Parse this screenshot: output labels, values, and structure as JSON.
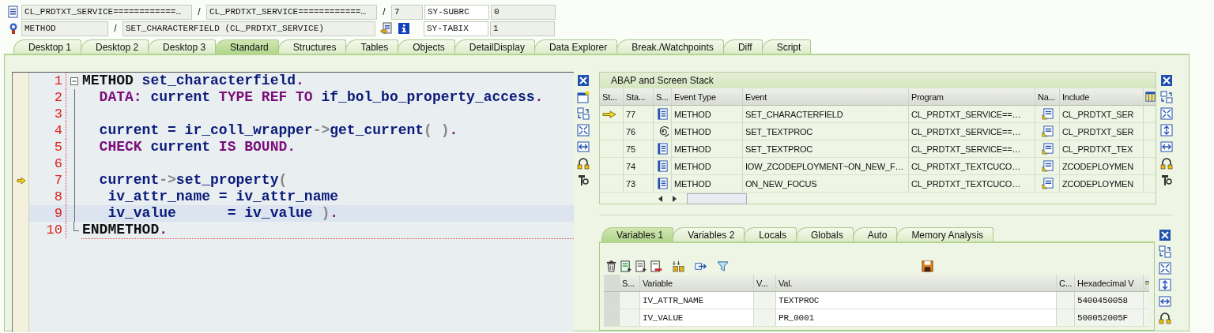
{
  "header": {
    "row_1": {
      "program": "CL_PRDTXT_SERVICE============…",
      "include": "CL_PRDTXT_SERVICE============…",
      "line": "7",
      "field_name": "SY-SUBRC",
      "field_value": "0"
    },
    "row_2": {
      "event_type": "METHOD",
      "event": "SET_CHARACTERFIELD (CL_PRDTXT_SERVICE)",
      "field_name": "SY-TABIX",
      "field_value": "1"
    },
    "separator": "/"
  },
  "tabs": [
    {
      "label": "Desktop 1",
      "selected": false
    },
    {
      "label": "Desktop 2",
      "selected": false
    },
    {
      "label": "Desktop 3",
      "selected": false
    },
    {
      "label": "Standard",
      "selected": true
    },
    {
      "label": "Structures",
      "selected": false
    },
    {
      "label": "Tables",
      "selected": false
    },
    {
      "label": "Objects",
      "selected": false
    },
    {
      "label": "DetailDisplay",
      "selected": false
    },
    {
      "label": "Data Explorer",
      "selected": false
    },
    {
      "label": "Break./Watchpoints",
      "selected": false
    },
    {
      "label": "Diff",
      "selected": false
    },
    {
      "label": "Script",
      "selected": false
    }
  ],
  "source_code": {
    "lines": [
      {
        "number": "1",
        "execution_marker": false,
        "highlighted": false,
        "tokens": [
          {
            "text": "METHOD",
            "kind": "keyword"
          },
          {
            "text": " set_characterfield",
            "kind": "name"
          },
          {
            "text": ".",
            "kind": "statement"
          }
        ]
      },
      {
        "number": "2",
        "execution_marker": false,
        "highlighted": false,
        "tokens": [
          {
            "text": "  DATA:",
            "kind": "statement"
          },
          {
            "text": " current",
            "kind": "name"
          },
          {
            "text": " TYPE REF TO",
            "kind": "statement"
          },
          {
            "text": " if_bol_bo_property_access",
            "kind": "name"
          },
          {
            "text": ".",
            "kind": "statement"
          }
        ]
      },
      {
        "number": "3",
        "execution_marker": false,
        "highlighted": false
      },
      {
        "number": "4",
        "execution_marker": false,
        "highlighted": false,
        "tokens": [
          {
            "text": "  current = ir_coll_wrapper",
            "kind": "name"
          },
          {
            "text": "->",
            "kind": "operator"
          },
          {
            "text": "get_current",
            "kind": "name"
          },
          {
            "text": "( )",
            "kind": "operator"
          },
          {
            "text": ".",
            "kind": "statement"
          }
        ]
      },
      {
        "number": "5",
        "execution_marker": false,
        "highlighted": false,
        "tokens": [
          {
            "text": "  CHECK",
            "kind": "statement"
          },
          {
            "text": " current",
            "kind": "name"
          },
          {
            "text": " IS BOUND",
            "kind": "statement"
          },
          {
            "text": ".",
            "kind": "statement"
          }
        ]
      },
      {
        "number": "6",
        "execution_marker": false,
        "highlighted": false
      },
      {
        "number": "7",
        "execution_marker": true,
        "highlighted": false,
        "tokens": [
          {
            "text": "  current",
            "kind": "name"
          },
          {
            "text": "->",
            "kind": "operator"
          },
          {
            "text": "set_property",
            "kind": "name"
          },
          {
            "text": "(",
            "kind": "operator"
          }
        ]
      },
      {
        "number": "8",
        "execution_marker": false,
        "highlighted": false,
        "tokens": [
          {
            "text": "   iv_attr_name = iv_attr_name",
            "kind": "name"
          }
        ]
      },
      {
        "number": "9",
        "execution_marker": false,
        "highlighted": true,
        "tokens": [
          {
            "text": "   iv_value      = iv_value",
            "kind": "name"
          },
          {
            "text": " )",
            "kind": "operator"
          },
          {
            "text": ".",
            "kind": "statement"
          }
        ]
      },
      {
        "number": "10",
        "execution_marker": false,
        "highlighted": false,
        "tokens": [
          {
            "text": "ENDMETHOD",
            "kind": "keyword"
          },
          {
            "text": ".",
            "kind": "statement"
          }
        ]
      }
    ]
  },
  "stack": {
    "title": "ABAP and Screen Stack",
    "columns": [
      "St...",
      "Sta...",
      "S...",
      "Event Type",
      "Event",
      "Program",
      "Na...",
      "Include"
    ],
    "rows": [
      {
        "current": true,
        "number": "77",
        "kind": "document",
        "event_type": "METHOD",
        "event": "SET_CHARACTERFIELD",
        "program": "CL_PRDTXT_SERVICE==…",
        "include": "CL_PRDTXT_SER"
      },
      {
        "current": false,
        "number": "76",
        "kind": "spiral",
        "event_type": "METHOD",
        "event": "SET_TEXTPROC",
        "program": "CL_PRDTXT_SERVICE==…",
        "include": "CL_PRDTXT_SER"
      },
      {
        "current": false,
        "number": "75",
        "kind": "document",
        "event_type": "METHOD",
        "event": "SET_TEXTPROC",
        "program": "CL_PRDTXT_SERVICE==…",
        "include": "CL_PRDTXT_TEX"
      },
      {
        "current": false,
        "number": "74",
        "kind": "document",
        "event_type": "METHOD",
        "event": "IOW_ZCODEPLOYMENT~ON_NEW_F…",
        "program": "CL_PRDTXT_TEXTCUCO…",
        "include": "ZCODEPLOYMEN"
      },
      {
        "current": false,
        "number": "73",
        "kind": "document",
        "event_type": "METHOD",
        "event": "ON_NEW_FOCUS",
        "program": "CL_PRDTXT_TEXTCUCO…",
        "include": "ZCODEPLOYMEN"
      }
    ]
  },
  "variables": {
    "tabs": [
      {
        "label": "Variables 1",
        "selected": true
      },
      {
        "label": "Variables 2",
        "selected": false
      },
      {
        "label": "Locals",
        "selected": false
      },
      {
        "label": "Globals",
        "selected": false
      },
      {
        "label": "Auto",
        "selected": false
      },
      {
        "label": "Memory Analysis",
        "selected": false
      }
    ],
    "columns": [
      "S...",
      "Variable",
      "V...",
      "Val.",
      "C...",
      "Hexadecimal V"
    ],
    "rows": [
      {
        "variable": "IV_ATTR_NAME",
        "value": "TEXTPROC",
        "hexadecimal": "5400450058"
      },
      {
        "variable": "IV_VALUE",
        "value": "PR_0001",
        "hexadecimal": "500052005F"
      }
    ]
  }
}
